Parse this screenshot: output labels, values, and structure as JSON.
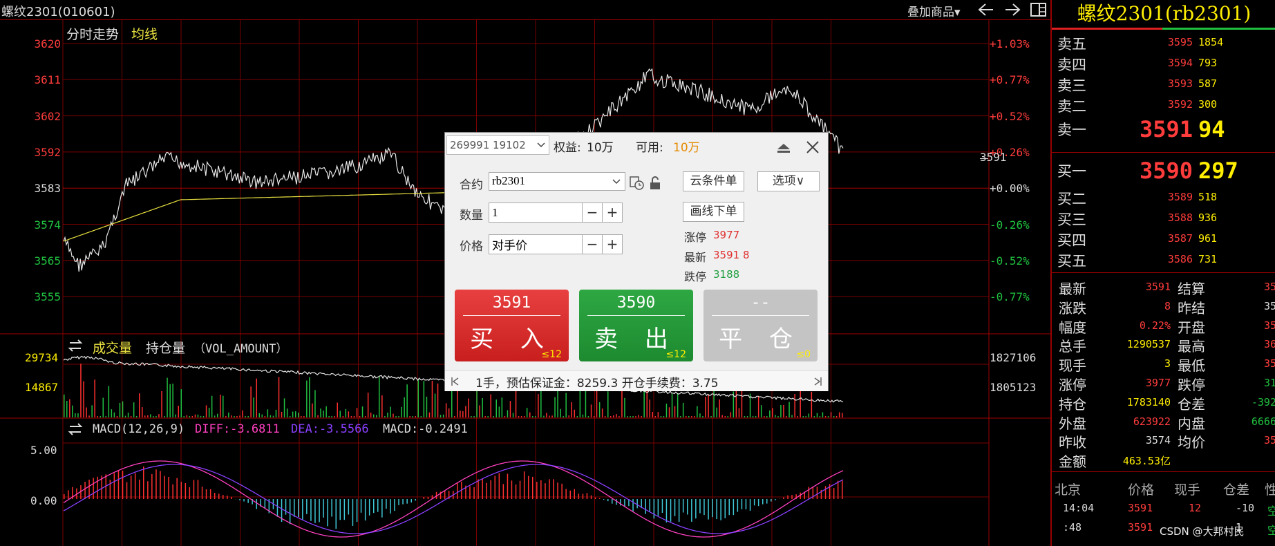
{
  "window": {
    "title": "螺纹2301(010601)",
    "overlay_label": "叠加商品",
    "overlay_arrow": "▾"
  },
  "chart": {
    "title": "分时走势",
    "avg_line_label": "均线",
    "price_ticks": [
      "3620",
      "3611",
      "3602",
      "3592",
      "3583",
      "3574",
      "3565",
      "3555"
    ],
    "pct_ticks": [
      "+1.03%",
      "+0.77%",
      "+0.52%",
      "+0.26%",
      "+0.00%",
      "-0.26%",
      "-0.52%",
      "-0.77%"
    ],
    "current_price_marker": "3591",
    "volume_panel": {
      "title": "成交量",
      "subtitle": "持仓量",
      "indicator": "（VOL_AMOUNT）",
      "left_ticks": [
        "29734",
        "14867"
      ],
      "right_ticks": [
        "1827106",
        "1805123"
      ]
    },
    "macd_panel": {
      "title": "MACD(12,26,9)",
      "diff": "DIFF:-3.6811",
      "dea": "DEA:-3.5566",
      "macd": "MACD:-0.2491",
      "ticks": [
        "5.00",
        "0.00"
      ]
    }
  },
  "order_dialog": {
    "account": "269991 19102",
    "equity_label": "权益:",
    "equity_value": "10万",
    "available_label": "可用:",
    "available_value": "10万",
    "contract_label": "合约",
    "contract_value": "rb2301",
    "quantity_label": "数量",
    "quantity_value": "1",
    "price_label": "价格",
    "price_value": "对手价",
    "cloud_order_button": "云条件单",
    "options_button": "选项∨",
    "draw_order_button": "画线下单",
    "limit_up_label": "涨停",
    "limit_up_value": "3977",
    "latest_label": "最新",
    "latest_value": "3591",
    "latest_change": "8",
    "limit_down_label": "跌停",
    "limit_down_value": "3188",
    "buy": {
      "price": "3591",
      "label": "买 入",
      "max_qty": "≤12"
    },
    "sell": {
      "price": "3590",
      "label": "卖 出",
      "max_qty": "≤12"
    },
    "close": {
      "price": "--",
      "label": "平 仓",
      "max_qty": "≤0"
    },
    "footer": "1手，预估保证金：8259.3 开仓手续费：3.75",
    "minus": "−",
    "plus": "+"
  },
  "quote_panel": {
    "title": "螺纹2301(rb2301)",
    "asks": [
      {
        "label": "卖五",
        "price": "3595",
        "vol": "1854"
      },
      {
        "label": "卖四",
        "price": "3594",
        "vol": "793"
      },
      {
        "label": "卖三",
        "price": "3593",
        "vol": "587"
      },
      {
        "label": "卖二",
        "price": "3592",
        "vol": "300"
      },
      {
        "label": "卖一",
        "price": "3591",
        "vol": "94"
      }
    ],
    "bids": [
      {
        "label": "买一",
        "price": "3590",
        "vol": "297"
      },
      {
        "label": "买二",
        "price": "3589",
        "vol": "518"
      },
      {
        "label": "买三",
        "price": "3588",
        "vol": "936"
      },
      {
        "label": "买四",
        "price": "3587",
        "vol": "961"
      },
      {
        "label": "买五",
        "price": "3586",
        "vol": "731"
      }
    ],
    "stats": [
      {
        "l": "最新",
        "v": "3591",
        "l2": "结算",
        "v2": "35"
      },
      {
        "l": "涨跌",
        "v": "8",
        "l2": "昨结",
        "v2": "35"
      },
      {
        "l": "幅度",
        "v": "0.22%",
        "l2": "开盘",
        "v2": "35"
      },
      {
        "l": "总手",
        "v": "1290537",
        "l2": "最高",
        "v2": "36"
      },
      {
        "l": "现手",
        "v": "3",
        "l2": "最低",
        "v2": "35"
      },
      {
        "l": "涨停",
        "v": "3977",
        "l2": "跌停",
        "v2": "31"
      },
      {
        "l": "持仓",
        "v": "1783140",
        "l2": "仓差",
        "v2": "-392"
      },
      {
        "l": "外盘",
        "v": "623922",
        "l2": "内盘",
        "v2": "6666"
      },
      {
        "l": "昨收",
        "v": "3574",
        "l2": "均价",
        "v2": "35"
      },
      {
        "l": "金额",
        "v": "463.53亿",
        "l2": "",
        "v2": ""
      }
    ],
    "ticks_header": [
      "北京",
      "价格",
      "现手",
      "仓差",
      "性"
    ],
    "ticks": [
      {
        "time": "14:04",
        "price": "3591",
        "qty": "12",
        "oi": "-10",
        "nature": "空"
      },
      {
        "time": ":48",
        "price": "3591",
        "qty": "",
        "oi": "1",
        "nature": "空"
      }
    ],
    "watermark": "CSDN @大邦村民"
  }
}
